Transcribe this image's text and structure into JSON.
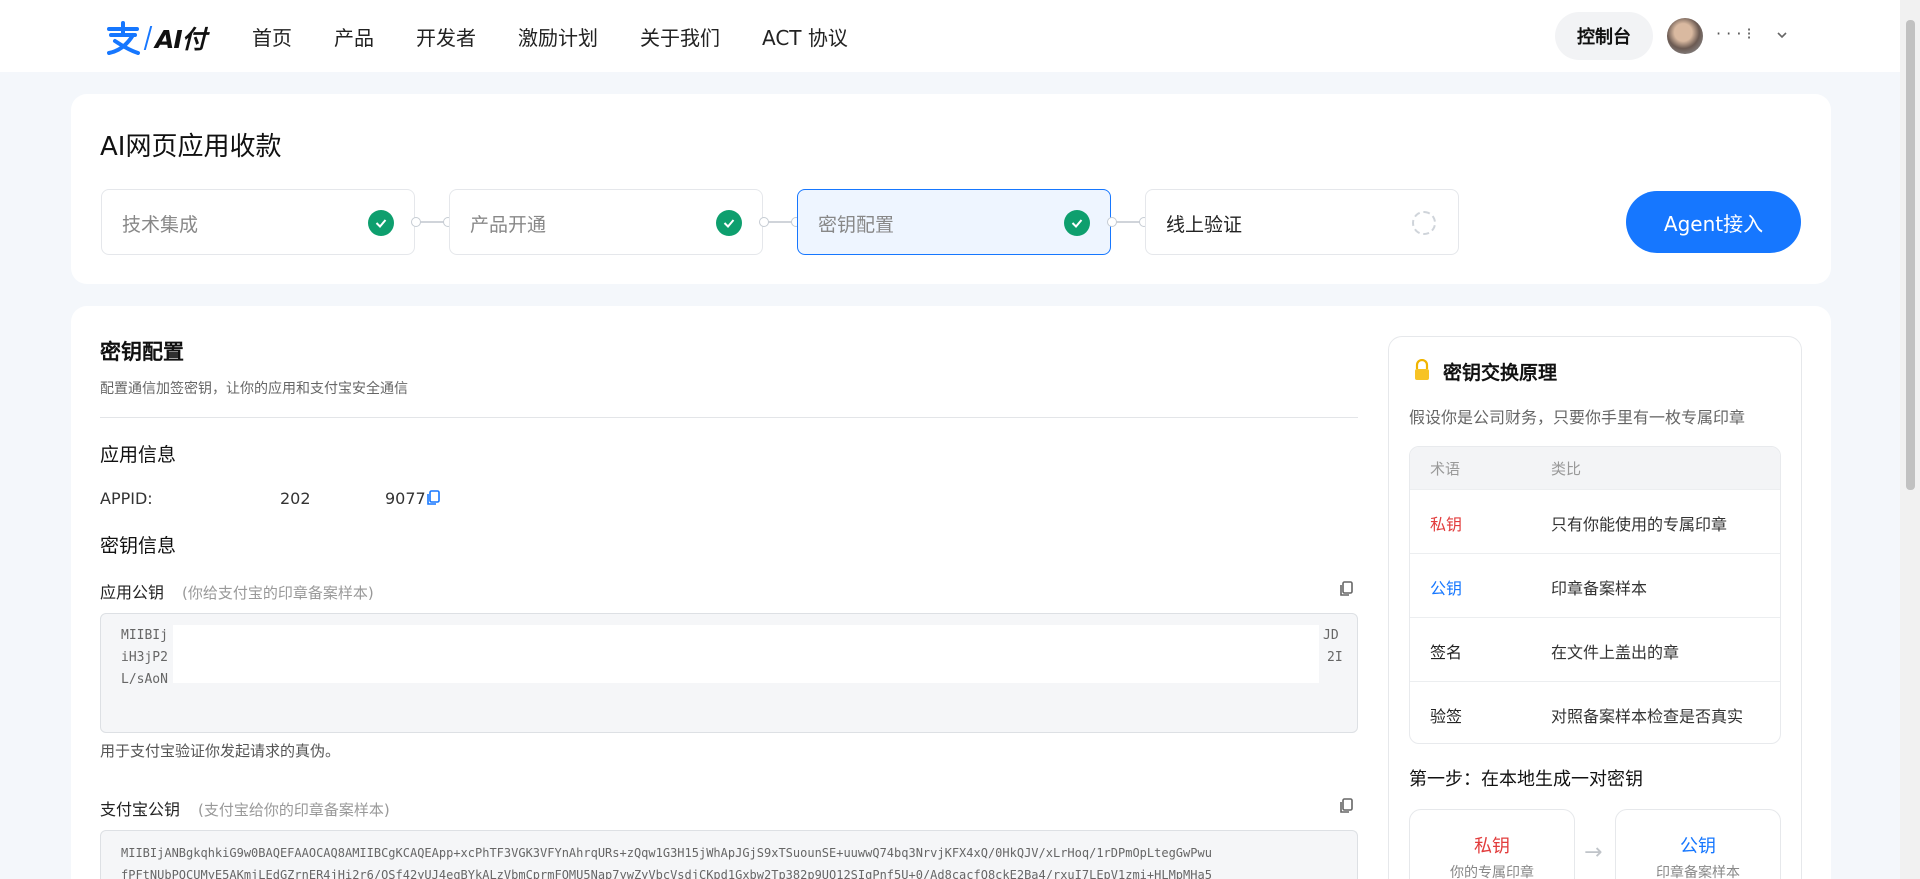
{
  "header": {
    "logo_text": "AI付",
    "nav": [
      "首页",
      "产品",
      "开发者",
      "激励计划",
      "关于我们",
      "ACT 协议"
    ],
    "console_label": "控制台",
    "user_name": "·  ·  ·  ⁝"
  },
  "top": {
    "title": "AI网页应用收款",
    "steps": [
      {
        "label": "技术集成",
        "status": "done"
      },
      {
        "label": "产品开通",
        "status": "done"
      },
      {
        "label": "密钥配置",
        "status": "done"
      },
      {
        "label": "线上验证",
        "status": "pending"
      }
    ],
    "agent_label": "Agent接入"
  },
  "main": {
    "title": "密钥配置",
    "subtitle": "配置通信加签密钥，让你的应用和支付宝安全通信",
    "app_info_heading": "应用信息",
    "appid_label": "APPID:",
    "appid_part1": "202",
    "appid_part2": "9077",
    "key_info_heading": "密钥信息",
    "app_public_key": {
      "label": "应用公钥",
      "hint": "(你给支付宝的印章备案样本)",
      "lines": [
        "MIIBIj",
        "iH3jP2",
        "L/sAoN"
      ],
      "line_tails": [
        "JD",
        "2I",
        ""
      ],
      "note": "用于支付宝验证你发起请求的真伪。"
    },
    "alipay_public_key": {
      "label": "支付宝公钥",
      "hint": "(支付宝给你的印章备案样本)",
      "lines": [
        "MIIBIjANBgkqhkiG9w0BAQEFAAOCAQ8AMIIBCgKCAQEApp+xcPhTF3VGK3VFYnAhrqURs+zQqw1G3H15jWhApJGjS9xTSuounSE+uuwwQ74bq3NrvjKFX4xQ/0HkQJV/xLrHoq/1rDPmOpLtegGwPwu",
        "fPFtNUbPQCUMyE5AKmjLEdGZrnER4jHi2r6/OSf42yUJ4egBYkALzVbmCprmFOMU5Nap7ywZyVbcVsdjCKpd1Gxbw2Tp382p9UQ12SIgPnf5U+0/Ad8cacfQ8ckE2Ba4/rxuI7LEpV1zmi+HLMpMHa5"
      ]
    }
  },
  "panel": {
    "title": "密钥交换原理",
    "desc": "假设你是公司财务，只要你手里有一枚专属印章",
    "head": [
      "术语",
      "类比"
    ],
    "rows": [
      {
        "term": "私钥",
        "analogy": "只有你能使用的专属印章",
        "color": "#e23c3c"
      },
      {
        "term": "公钥",
        "analogy": "印章备案样本",
        "color": "#1677ff"
      },
      {
        "term": "签名",
        "analogy": "在文件上盖出的章",
        "color": "#222222"
      },
      {
        "term": "验签",
        "analogy": "对照备案样本检查是否真实",
        "color": "#222222"
      }
    ],
    "step1": "第一步：在本地生成一对密钥",
    "private_card": {
      "name": "私钥",
      "desc": "你的专属印章"
    },
    "public_card": {
      "name": "公钥",
      "desc": "印章备案样本"
    },
    "arrow": "→"
  },
  "colors": {
    "accent": "#1677ff",
    "success": "#0e9f6e",
    "danger": "#e23c3c"
  }
}
